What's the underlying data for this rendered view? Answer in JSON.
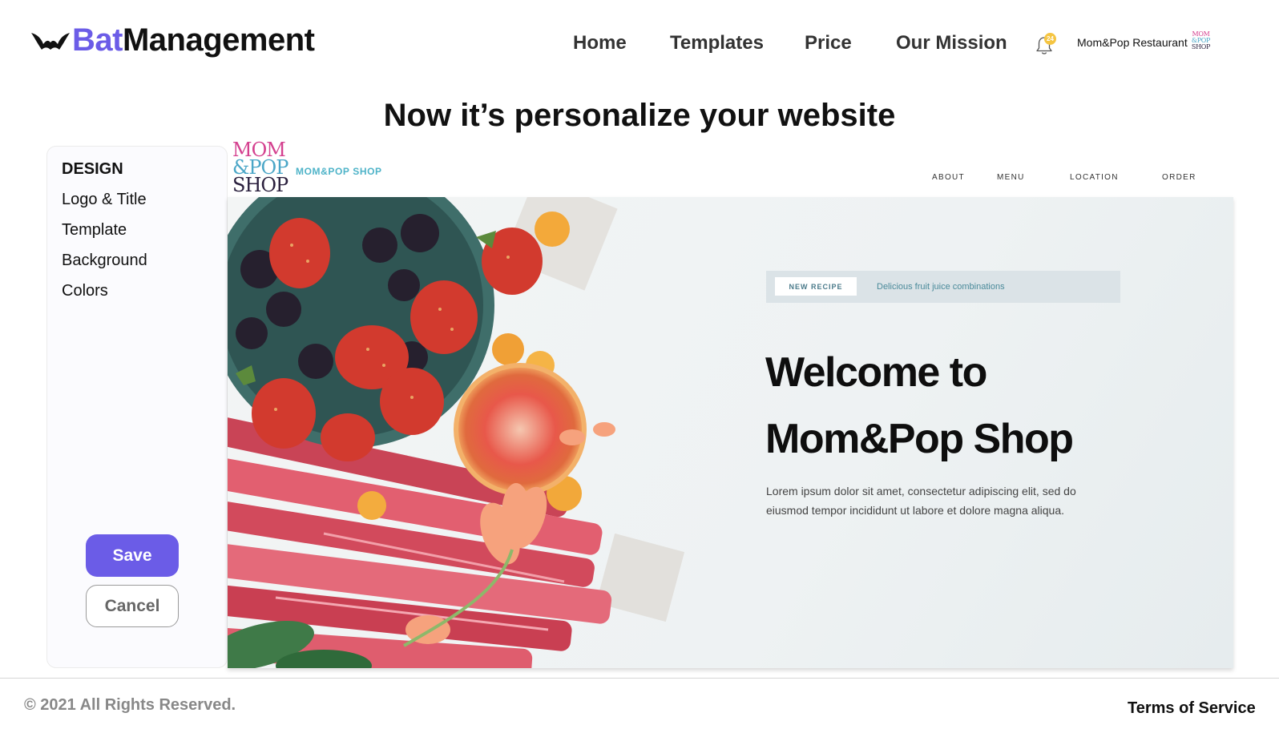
{
  "app": {
    "brand_part1": "Bat",
    "brand_part2": "Management",
    "logo_icon": "bat-icon",
    "accent_color": "#6b5ce7"
  },
  "nav": {
    "items": [
      {
        "label": "Home"
      },
      {
        "label": "Templates"
      },
      {
        "label": "Price"
      },
      {
        "label": "Our Mission"
      }
    ],
    "notification_icon": "bell-icon",
    "notification_count": "24",
    "account_name": "Mom&Pop Restaurant",
    "avatar_text": [
      "MOM",
      "&POP",
      "SHOP"
    ]
  },
  "page_title": "Now it’s personalize your website",
  "sidebar": {
    "heading": "DESIGN",
    "items": [
      {
        "label": "Logo & Title"
      },
      {
        "label": "Template"
      },
      {
        "label": "Background"
      },
      {
        "label": "Colors"
      }
    ],
    "save_label": "Save",
    "cancel_label": "Cancel"
  },
  "preview": {
    "logo_lines": [
      "MOM",
      "&POP",
      "SHOP"
    ],
    "brand_name": "MOM&POP SHOP",
    "nav": [
      "ABOUT",
      "MENU",
      "LOCATION",
      "ORDER"
    ],
    "badge_label": "NEW RECIPE",
    "badge_text": "Delicious fruit juice combinations",
    "hero_title_line1": "Welcome to",
    "hero_title_line2": "Mom&Pop Shop",
    "hero_text": "Lorem ipsum dolor sit amet, consectetur adipiscing elit, sed do eiusmod tempor incididunt ut labore et dolore magna aliqua.",
    "brand_colors": {
      "pink": "#d4408f",
      "teal": "#4eb3c8",
      "dark": "#2a1f3d"
    }
  },
  "footer": {
    "copyright": "© 2021 All Rights Reserved.",
    "terms": "Terms of Service"
  }
}
